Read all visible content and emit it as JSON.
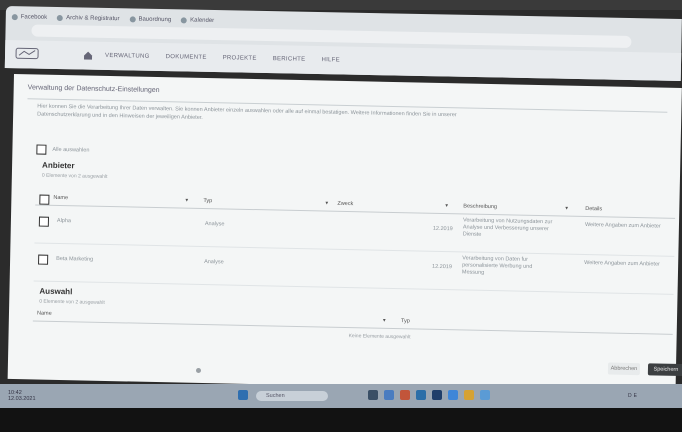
{
  "browser": {
    "bookmarks": [
      "Facebook",
      "Archiv & Registratur",
      "Bauordnung",
      "Kalender"
    ],
    "menu": [
      "VERWALTUNG",
      "DOKUMENTE",
      "PROJEKTE",
      "BERICHTE",
      "HILFE"
    ]
  },
  "page": {
    "title": "Verwaltung der Datenschutz-Einstellungen",
    "description": "Hier konnen Sie die Verarbeitung Ihrer Daten verwalten. Sie konnen Anbieter einzeln auswahlen oder alle auf einmal bestatigen. Weitere Informationen finden Sie in unserer Datenschutzerklarung und in den Hinweisen der jeweiligen Anbieter.",
    "checkbox_label": "Alle auswahlen",
    "sections": {
      "available_title": "Anbieter",
      "available_sub": "0 Elemente von 2 ausgewahlt",
      "selected_title": "Auswahl",
      "selected_sub": "0 Elemente von 2 ausgewahlt"
    },
    "table": {
      "headers": [
        "Name",
        "Typ",
        "Zweck",
        "Beschreibung",
        "Details"
      ],
      "rows": [
        {
          "name": "Alpha",
          "type": "Analyse",
          "date": "12.2019",
          "desc": "Verarbeitung von Nutzungsdaten zur Analyse und Verbesserung unserer Dienste",
          "details": "Weitere Angaben zum Anbieter"
        },
        {
          "name": "Beta Marketing",
          "type": "Analyse",
          "date": "12.2019",
          "desc": "Verarbeitung von Daten fur personalisierte Werbung und Messung",
          "details": "Weitere Angaben zum Anbieter"
        }
      ]
    },
    "selected_row": {
      "name": "Name",
      "type": "Typ"
    },
    "link_text": "Keine Elemente ausgewahlt",
    "buttons": {
      "cancel": "Abbrechen",
      "save": "Speichern"
    }
  },
  "taskbar": {
    "search_placeholder": "Suchen",
    "time": "10:42",
    "date": "12.03.2021",
    "tray": "DE"
  },
  "colors": {
    "accent": "#3c3f41",
    "taskbar": "#9aa6b3",
    "page": "#f4f6f6"
  }
}
